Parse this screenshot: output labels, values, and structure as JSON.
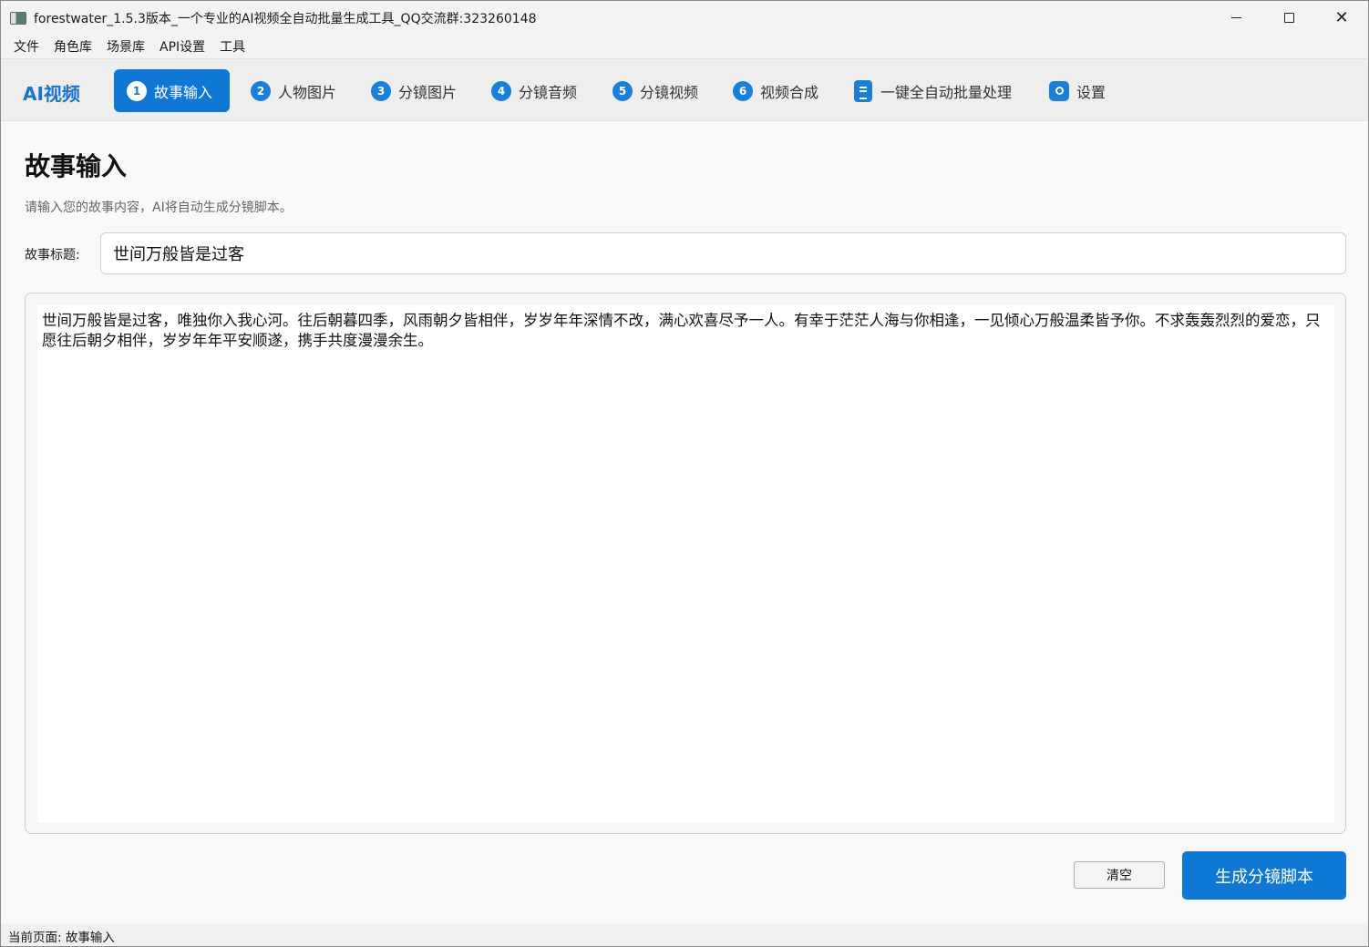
{
  "window": {
    "title": "forestwater_1.5.3版本_一个专业的AI视频全自动批量生成工具_QQ交流群:323260148",
    "close_glyph": "✕"
  },
  "menu": [
    "文件",
    "角色库",
    "场景库",
    "API设置",
    "工具"
  ],
  "nav": {
    "brand": "AI视频",
    "tabs": [
      {
        "num": "1",
        "label": "故事输入",
        "active": true
      },
      {
        "num": "2",
        "label": "人物图片"
      },
      {
        "num": "3",
        "label": "分镜图片"
      },
      {
        "num": "4",
        "label": "分镜音频"
      },
      {
        "num": "5",
        "label": "分镜视频"
      },
      {
        "num": "6",
        "label": "视频合成"
      },
      {
        "icon": "document-icon",
        "label": "一键全自动批量处理"
      },
      {
        "icon": "gear-icon",
        "label": "设置"
      }
    ]
  },
  "page": {
    "title": "故事输入",
    "description": "请输入您的故事内容，AI将自动生成分镜脚本。",
    "story_title_label": "故事标题:",
    "story_title_value": "世间万般皆是过客",
    "story_content": "世间万般皆是过客，唯独你入我心河。往后朝暮四季，风雨朝夕皆相伴，岁岁年年深情不改，满心欢喜尽予一人。有幸于茫茫人海与你相逢，一见倾心万般温柔皆予你。不求轰轰烈烈的爱恋，只愿往后朝夕相伴，岁岁年年平安顺遂，携手共度漫漫余生。"
  },
  "buttons": {
    "clear": "清空",
    "generate": "生成分镜脚本"
  },
  "status": {
    "text": "当前页面: 故事输入"
  },
  "colors": {
    "accent": "#0f78d4",
    "brand": "#1a73c9"
  }
}
